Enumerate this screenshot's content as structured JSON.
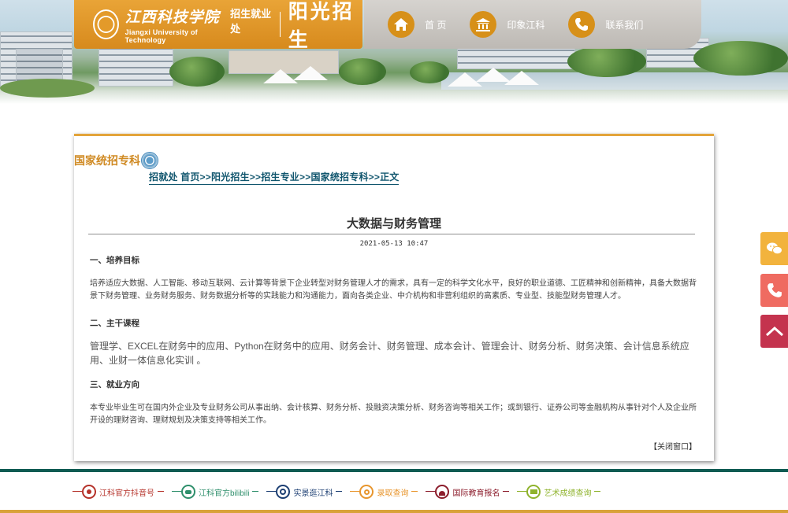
{
  "header": {
    "school_name_cn": "江西科技学院",
    "school_name_en": "Jiangxi University of Technology",
    "dept": "招生就业处",
    "portal_title": "阳光招生",
    "nav": [
      {
        "label": "首 页",
        "icon": "home-icon"
      },
      {
        "label": "印象江科",
        "icon": "temple-icon"
      },
      {
        "label": "联系我们",
        "icon": "phone-icon"
      }
    ]
  },
  "section": {
    "title": "国家统招专科",
    "breadcrumb": [
      "招就处 首页",
      "阳光招生",
      "招生专业",
      "国家统招专科",
      "正文"
    ],
    "breadcrumb_sep": ">>"
  },
  "article": {
    "title": "大数据与财务管理",
    "date": "2021-05-13 10:47",
    "h1": "一、培养目标",
    "p1": "培养适应大数据、人工智能、移动互联网、云计算等背景下企业转型对财务管理人才的需求，具有一定的科学文化水平，良好的职业道德、工匠精神和创新精神，具备大数据背景下财务管理、业务财务服务、财务数据分析等的实践能力和沟通能力，面向各类企业、中介机构和非营利组织的高素质、专业型、技能型财务管理人才。",
    "h2": "二、主干课程",
    "p2": "管理学、EXCEL在财务中的应用、Python在财务中的应用、财务会计、财务管理、成本会计、管理会计、财务分析、财务决策、会计信息系统应用、业财一体信息化实训 。",
    "h3": "三、就业方向",
    "p3": "本专业毕业生可在国内外企业及专业财务公司从事出纳、会计核算、财务分析、投融资决策分析、财务咨询等相关工作；或到银行、证券公司等金融机构从事针对个人及企业所开设的理财咨询、理财规划及决策支持等相关工作。",
    "close_label": "【关闭窗口】"
  },
  "footer": {
    "links": [
      {
        "label": "江科官方抖音号",
        "color": "#b5322a",
        "icon": "douyin-icon"
      },
      {
        "label": "江科官方bilibili",
        "color": "#2f8f6c",
        "icon": "bilibili-icon"
      },
      {
        "label": "实景逛江科",
        "color": "#1d3f73",
        "icon": "globe-icon"
      },
      {
        "label": "录取查询",
        "color": "#e8962e",
        "icon": "search-icon"
      },
      {
        "label": "国际教育报名",
        "color": "#8c1d2c",
        "icon": "people-icon"
      },
      {
        "label": "艺术成绩查询",
        "color": "#8fb32d",
        "icon": "screen-icon"
      }
    ]
  },
  "floats": {
    "wechat": "wechat-icon",
    "phone": "phone-icon",
    "top": "back-to-top-icon"
  }
}
